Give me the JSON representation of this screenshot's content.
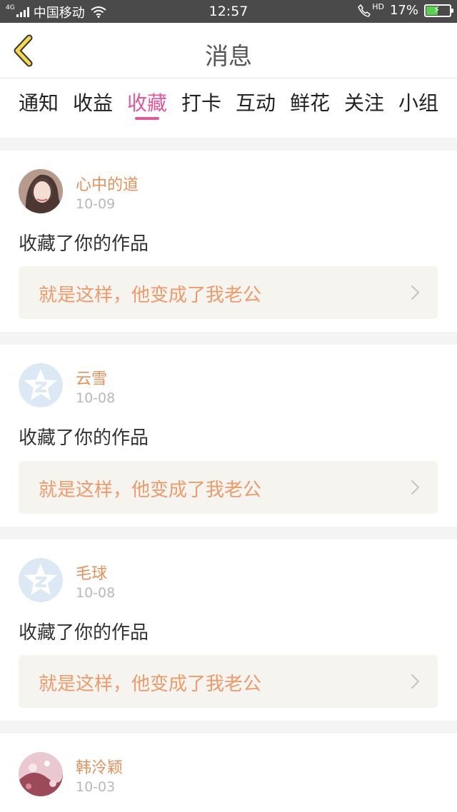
{
  "status_bar": {
    "network": "4G",
    "carrier": "中国移动",
    "time": "12:57",
    "hd": "HD",
    "battery": "17%",
    "battery_level": 0.17
  },
  "header": {
    "title": "消息"
  },
  "tabs": [
    {
      "label": "通知"
    },
    {
      "label": "收益"
    },
    {
      "label": "收藏"
    },
    {
      "label": "打卡"
    },
    {
      "label": "互动"
    },
    {
      "label": "鲜花"
    },
    {
      "label": "关注"
    },
    {
      "label": "小组"
    }
  ],
  "active_tab": "收藏",
  "colors": {
    "accent": "#e6579a",
    "name": "#e5915a",
    "work_title": "#ee9a6b",
    "link_bg": "#f5f4ef"
  },
  "feed": [
    {
      "name": "心中的道",
      "date": "10-09",
      "action": "收藏了你的作品",
      "work_title": "就是这样，他变成了我老公",
      "avatar": "photo-avatar"
    },
    {
      "name": "云雪",
      "date": "10-08",
      "action": "收藏了你的作品",
      "work_title": "就是这样，他变成了我老公",
      "avatar": "qzone-default-avatar"
    },
    {
      "name": "毛球",
      "date": "10-08",
      "action": "收藏了你的作品",
      "work_title": "就是这样，他变成了我老公",
      "avatar": "qzone-default-avatar"
    },
    {
      "name": "韩泠颖",
      "date": "10-03",
      "avatar": "photo-avatar"
    }
  ]
}
